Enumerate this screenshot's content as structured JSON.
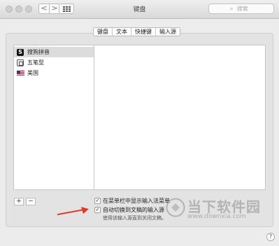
{
  "window": {
    "title": "键盘",
    "nav_back": "<",
    "nav_forward": ">",
    "search_placeholder": "搜索"
  },
  "tabs": [
    {
      "label": "键盘"
    },
    {
      "label": "文本"
    },
    {
      "label": "快捷键"
    },
    {
      "label": "输入源",
      "selected": true
    }
  ],
  "input_sources": [
    {
      "label": "搜狗拼音",
      "icon": "sogou-icon",
      "selected": true
    },
    {
      "label": "五笔型",
      "icon": "wubi-icon"
    },
    {
      "label": "美国",
      "icon": "us-flag-icon"
    }
  ],
  "controls": {
    "add_label": "+",
    "remove_label": "−"
  },
  "options": [
    {
      "label": "在菜单栏中显示输入法菜单",
      "checked": true,
      "check_glyph": "✓"
    },
    {
      "label": "自动切换到文稿的输入源",
      "checked": true,
      "check_glyph": "✓"
    }
  ],
  "option_note": "使用该输入源直到关闭文稿。",
  "help_label": "?",
  "watermark": {
    "title": "当下软件园",
    "url": "www.downxia.com"
  },
  "colors": {
    "arrow": "#e23a2a",
    "selection": "#dcdcdc"
  }
}
